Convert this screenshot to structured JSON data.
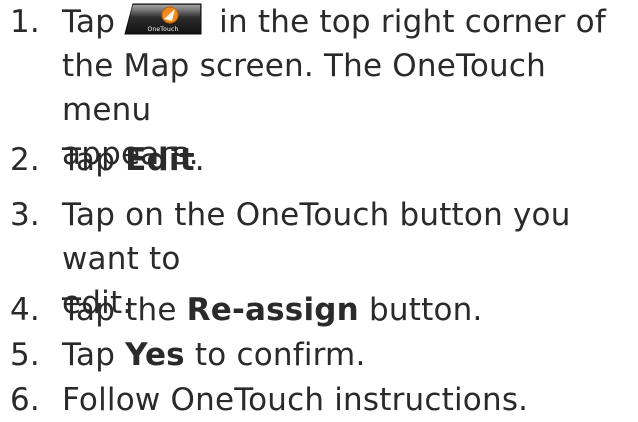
{
  "steps": [
    {
      "number": "1.",
      "line1_before_icon": "Tap",
      "icon": "onetouch-button-icon",
      "icon_label": "OneTouch",
      "line1_after_icon": "in the top right corner of",
      "line2": "the Map screen. The OneTouch menu",
      "line3": "appears."
    },
    {
      "number": "2.",
      "before": "Tap ",
      "bold": "Edit",
      "after": "."
    },
    {
      "number": "3.",
      "line1": "Tap on the OneTouch button you want to",
      "line2": "edit."
    },
    {
      "number": "4.",
      "before": "Tap the ",
      "bold": "Re-assign",
      "after": " button."
    },
    {
      "number": "5.",
      "before": "Tap ",
      "bold": "Yes",
      "after": " to confirm."
    },
    {
      "number": "6.",
      "text": "Follow OneTouch instructions."
    }
  ],
  "colors": {
    "text": "#2a2a2a",
    "icon_dark": "#1c1c1c",
    "icon_accent": "#f08a1c"
  }
}
